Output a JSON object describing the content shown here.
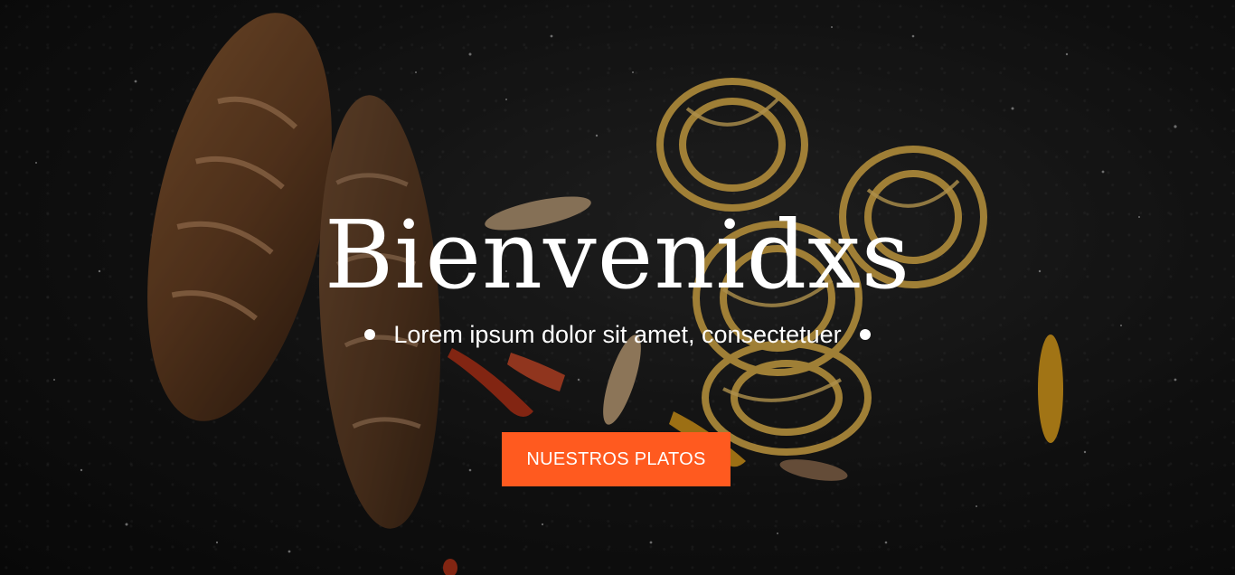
{
  "hero": {
    "title": "Bienvenidxs",
    "subtitle": "Lorem ipsum dolor sit amet, consectetuer",
    "cta_label": "NUESTROS PLATOS",
    "accent_color": "#ff5a1f",
    "background_image": "food-photo-bread-pasta-flour"
  }
}
